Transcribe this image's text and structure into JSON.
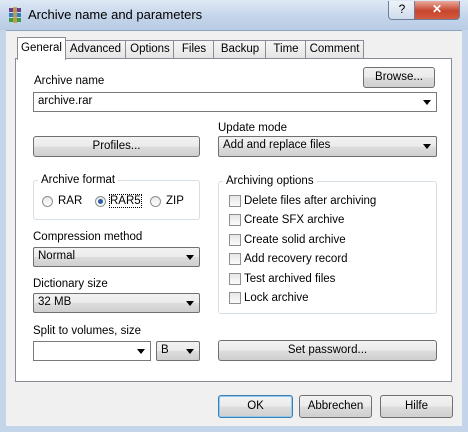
{
  "window": {
    "title": "Archive name and parameters",
    "help_label": "?",
    "close_label": "✕"
  },
  "tabs": [
    "General",
    "Advanced",
    "Options",
    "Files",
    "Backup",
    "Time",
    "Comment"
  ],
  "archive_name": {
    "label": "Archive name",
    "value": "archive.rar",
    "browse_label": "Browse..."
  },
  "profiles_label": "Profiles...",
  "update_mode": {
    "label": "Update mode",
    "value": "Add and replace files"
  },
  "archive_format": {
    "label": "Archive format",
    "options": [
      "RAR",
      "RAR5",
      "ZIP"
    ],
    "selected": "RAR5"
  },
  "compression": {
    "label": "Compression method",
    "value": "Normal"
  },
  "dictionary": {
    "label": "Dictionary size",
    "value": "32 MB"
  },
  "split": {
    "label": "Split to volumes, size",
    "value": "",
    "unit": "B"
  },
  "archiving_options": {
    "label": "Archiving options",
    "items": [
      "Delete files after archiving",
      "Create SFX archive",
      "Create solid archive",
      "Add recovery record",
      "Test archived files",
      "Lock archive"
    ]
  },
  "set_password_label": "Set password...",
  "buttons": {
    "ok": "OK",
    "cancel": "Abbrechen",
    "help": "Hilfe"
  }
}
